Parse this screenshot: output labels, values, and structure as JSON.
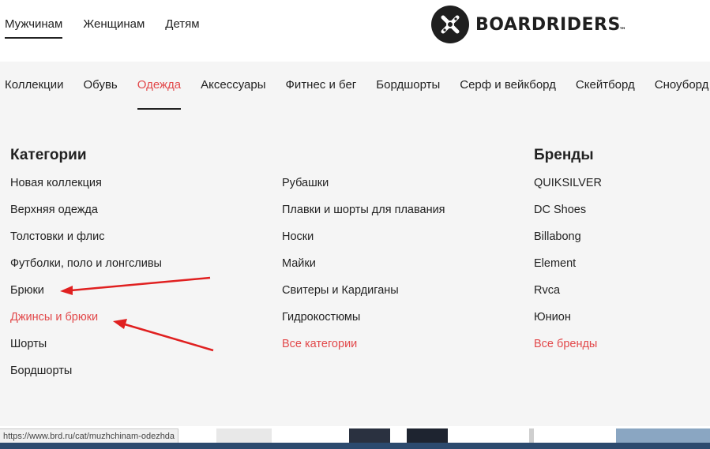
{
  "header": {
    "gender_tabs": [
      {
        "label": "Мужчинам",
        "active": true
      },
      {
        "label": "Женщинам",
        "active": false
      },
      {
        "label": "Детям",
        "active": false
      }
    ],
    "logo_text": "BOARDRIDERS",
    "logo_tm": "™"
  },
  "nav": {
    "items": [
      {
        "label": "Коллекции"
      },
      {
        "label": "Обувь"
      },
      {
        "label": "Одежда",
        "active": true
      },
      {
        "label": "Аксессуары"
      },
      {
        "label": "Фитнес и бег"
      },
      {
        "label": "Бордшорты"
      },
      {
        "label": "Серф и вейкборд"
      },
      {
        "label": "Скейтборд"
      },
      {
        "label": "Сноуборд"
      }
    ]
  },
  "menu": {
    "categories_title": "Категории",
    "categories_col1": [
      "Новая коллекция",
      "Верхняя одежда",
      "Толстовки и флис",
      "Футболки, поло и лонгсливы",
      "Брюки",
      "Джинсы и брюки",
      "Шорты",
      "Бордшорты"
    ],
    "categories_col2": [
      "Рубашки",
      "Плавки и шорты для плавания",
      "Носки",
      "Майки",
      "Свитеры и Кардиганы",
      "Гидрокостюмы",
      "Все категории"
    ],
    "brands_title": "Бренды",
    "brands": [
      "QUIKSILVER",
      "DC Shoes",
      "Billabong",
      "Element",
      "Rvca",
      "Юнион",
      "Все бренды"
    ]
  },
  "status_url": "https://www.brd.ru/cat/muzhchinam-odezhda",
  "colors": {
    "accent": "#e2484a",
    "text": "#222222",
    "background": "#f5f5f5",
    "annotation_arrow": "#e02020"
  }
}
